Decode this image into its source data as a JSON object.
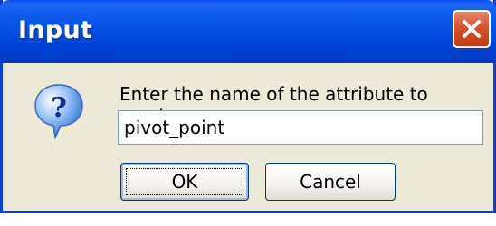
{
  "dialog": {
    "title": "Input",
    "prompt": "Enter the name of the attribute to create.",
    "input_value": "pivot_point",
    "ok_label": "OK",
    "cancel_label": "Cancel",
    "icon": "question-icon",
    "close_icon": "close-icon"
  },
  "colors": {
    "titlebar": "#0054e3",
    "window_bg": "#ece9d8",
    "close_button": "#d9522d",
    "icon_blue": "#2a6fd1"
  }
}
